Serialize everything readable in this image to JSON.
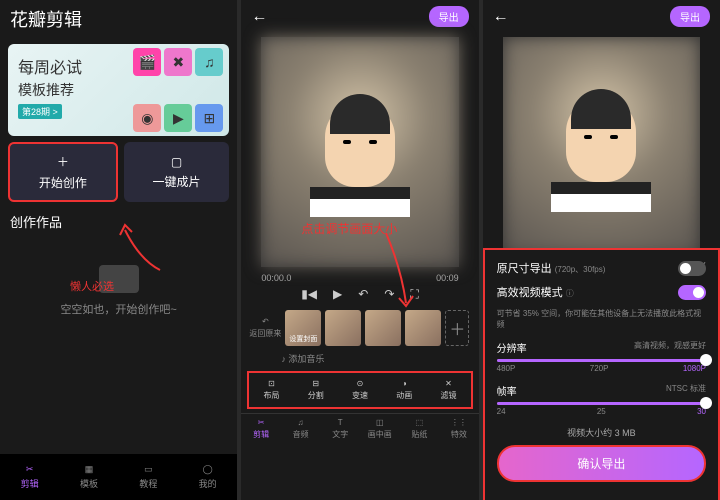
{
  "screen1": {
    "title": "花瓣剪辑",
    "banner": {
      "line1": "每周必试",
      "line2": "模板推荐",
      "badge": "第28期 >"
    },
    "actions": {
      "create": "开始创作",
      "quick": "一键成片"
    },
    "section": "创作作品",
    "annotation": "懒人必选",
    "empty": "空空如也，开始创作吧~",
    "tabs": [
      "剪辑",
      "模板",
      "教程",
      "我的"
    ]
  },
  "screen2": {
    "back": "←",
    "export": "导出",
    "annotation": "点击调节画面大小",
    "time_current": "00:00.0",
    "time_total": "00:09",
    "undo": "返回原来",
    "clip_label": "设置封面",
    "music": "♪ 添加音乐",
    "tools": [
      {
        "icon": "⊡",
        "label": "布局"
      },
      {
        "icon": "⊟",
        "label": "分割"
      },
      {
        "icon": "⊙",
        "label": "变速"
      },
      {
        "icon": "◑",
        "label": "动画"
      },
      {
        "icon": "✕",
        "label": "滤镜"
      }
    ],
    "bottom_tools": [
      {
        "icon": "✂",
        "label": "剪辑"
      },
      {
        "icon": "♫",
        "label": "音频"
      },
      {
        "icon": "T",
        "label": "文字"
      },
      {
        "icon": "◫",
        "label": "画中画"
      },
      {
        "icon": "⬚",
        "label": "贴纸"
      },
      {
        "icon": "⋮⋮",
        "label": "特效"
      }
    ]
  },
  "screen3": {
    "back": "←",
    "export": "导出",
    "original_label": "原尺寸导出",
    "original_hint": "(720p、30fps)",
    "efficient_label": "高效视频模式",
    "efficient_note": "可节省 35% 空间，你可能在其他设备上无法播放此格式视频",
    "resolution_label": "分辨率",
    "resolution_hint": "高清视频，观感更好",
    "resolution_ticks": [
      "480P",
      "720P",
      "1080P"
    ],
    "framerate_label": "帧率",
    "framerate_hint": "NTSC 标准",
    "framerate_ticks": [
      "24",
      "25",
      "30"
    ],
    "size_text": "视频大小约 3 MB",
    "confirm": "确认导出"
  }
}
